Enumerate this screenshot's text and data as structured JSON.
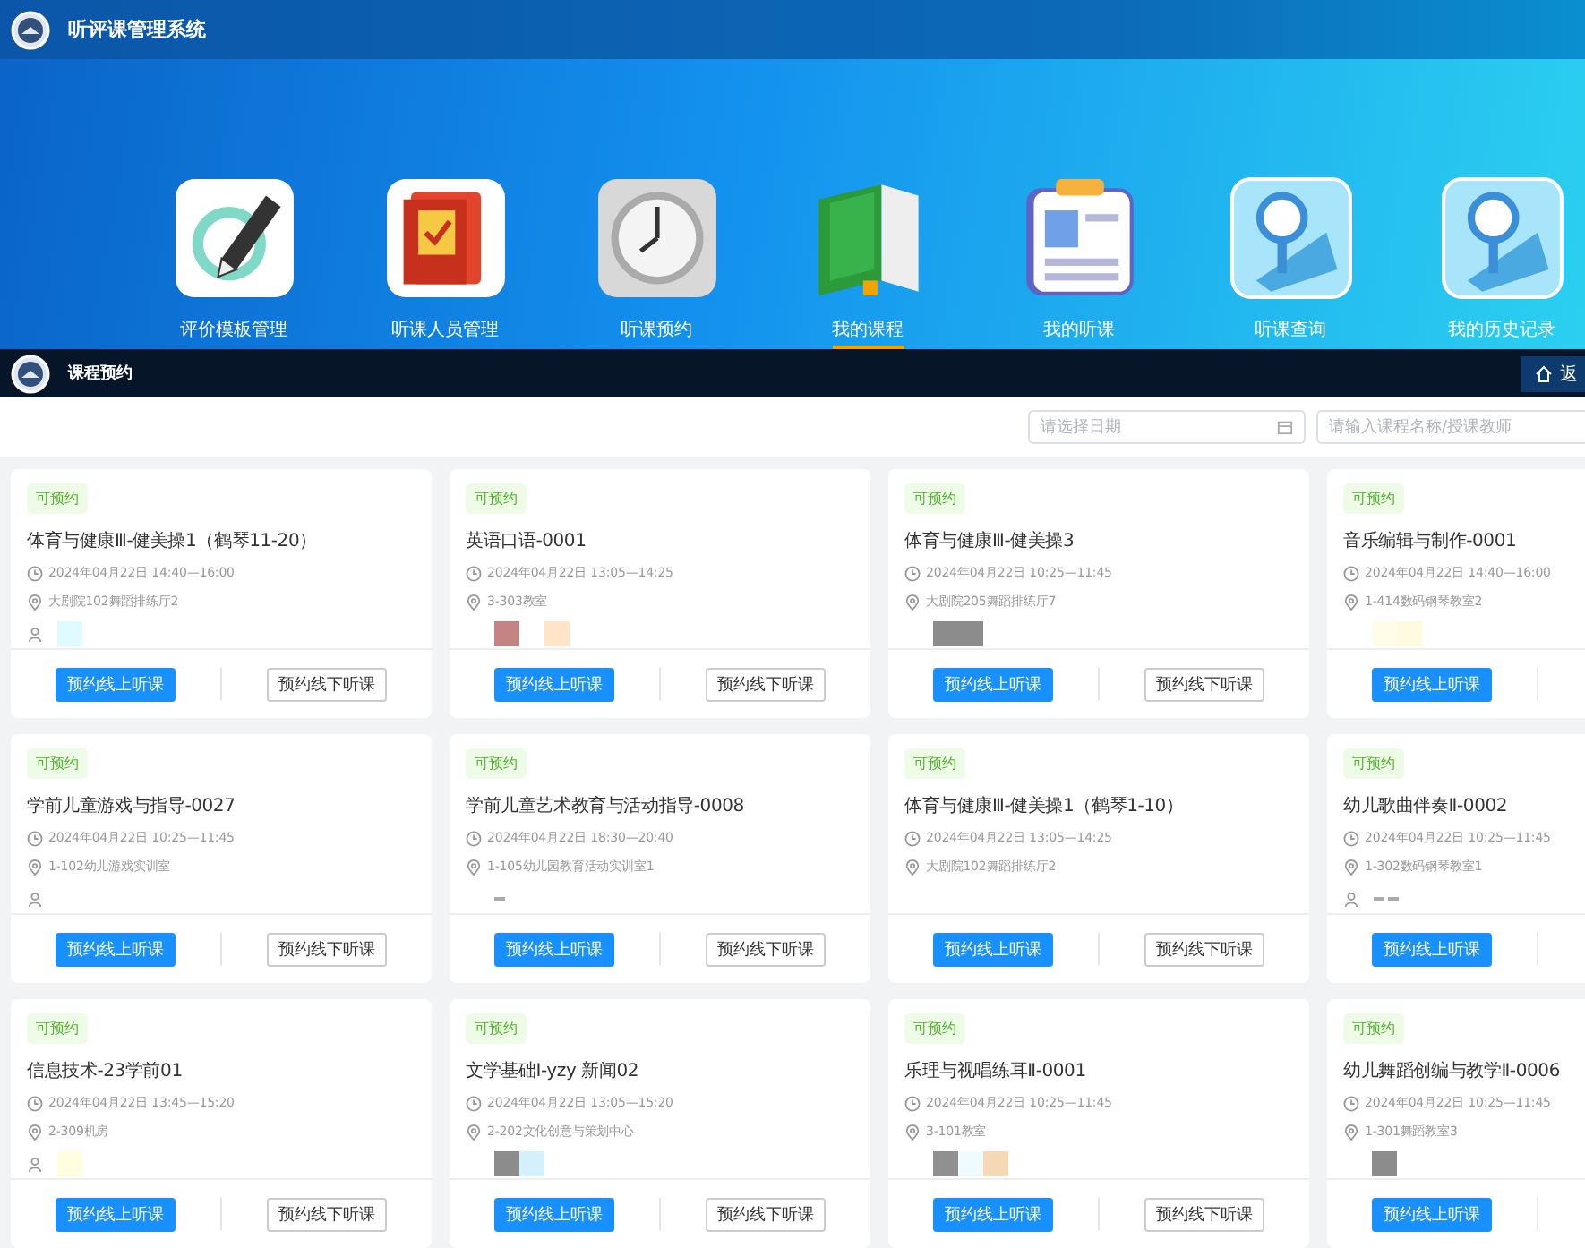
{
  "app": {
    "title": "听评课管理系统"
  },
  "nav": [
    {
      "label": "评价模板管理",
      "kind": "pen",
      "selected": false
    },
    {
      "label": "听课人员管理",
      "kind": "book",
      "selected": false
    },
    {
      "label": "听课预约",
      "kind": "clock",
      "selected": false
    },
    {
      "label": "我的课程",
      "kind": "course",
      "selected": true
    },
    {
      "label": "我的听课",
      "kind": "profile",
      "selected": false
    },
    {
      "label": "听课查询",
      "kind": "search",
      "selected": false
    },
    {
      "label": "我的历史记录",
      "kind": "search",
      "selected": false
    }
  ],
  "subbar": {
    "title": "课程预约",
    "back_button": "返"
  },
  "filters": {
    "date_placeholder": "请选择日期",
    "search_placeholder": "请输入课程名称/授课教师"
  },
  "cards": [
    {
      "tag": "可预约",
      "title": "体育与健康Ⅲ-健美操1（鹤琴11-20）",
      "time": "2024年04月22日 14:40—16:00",
      "location": "大剧院102舞蹈排练厅2",
      "person_icon": true,
      "blocks": [
        {
          "kind": "square",
          "color": "#e0fbff"
        }
      ],
      "online_button": "预约线上听课",
      "offline_button": "预约线下听课"
    },
    {
      "tag": "可预约",
      "title": "英语口语-0001",
      "time": "2024年04月22日 13:05—14:25",
      "location": "3-303教室",
      "person_icon": false,
      "blocks": [
        {
          "kind": "square",
          "color": "#c48484"
        },
        {
          "kind": "gap"
        },
        {
          "kind": "square",
          "color": "#ffe4c8"
        }
      ],
      "online_button": "预约线上听课",
      "offline_button": "预约线下听课"
    },
    {
      "tag": "可预约",
      "title": "体育与健康Ⅲ-健美操3",
      "time": "2024年04月22日 10:25—11:45",
      "location": "大剧院205舞蹈排练厅7",
      "person_icon": false,
      "blocks": [
        {
          "kind": "wide",
          "color": "#8c8c8c"
        }
      ],
      "online_button": "预约线上听课",
      "offline_button": "预约线下听课"
    },
    {
      "tag": "可预约",
      "title": "音乐编辑与制作-0001",
      "time": "2024年04月22日 14:40—16:00",
      "location": "1-414数码钢琴教室2",
      "person_icon": false,
      "blocks": [
        {
          "kind": "square",
          "color": "#fffde8"
        },
        {
          "kind": "square",
          "color": "#fffbe0"
        }
      ],
      "online_button": "预约线上听课"
    },
    {
      "tag": "可预约",
      "title": "学前儿童游戏与指导-0027",
      "time": "2024年04月22日 10:25—11:45",
      "location": "1-102幼儿游戏实训室",
      "person_icon": true,
      "online_button": "预约线上听课",
      "offline_button": "预约线下听课"
    },
    {
      "tag": "可预约",
      "title": "学前儿童艺术教育与活动指导-0008",
      "time": "2024年04月22日 18:30—20:40",
      "location": "1-105幼儿园教育活动实训室1",
      "person_icon": false,
      "blocks": [
        {
          "kind": "dash",
          "color": "#aaaaaa"
        }
      ],
      "online_button": "预约线上听课",
      "offline_button": "预约线下听课"
    },
    {
      "tag": "可预约",
      "title": "体育与健康Ⅲ-健美操1（鹤琴1-10）",
      "time": "2024年04月22日 13:05—14:25",
      "location": "大剧院102舞蹈排练厅2",
      "person_icon": false,
      "online_button": "预约线上听课",
      "offline_button": "预约线下听课"
    },
    {
      "tag": "可预约",
      "title": "幼儿歌曲伴奏Ⅱ-0002",
      "time": "2024年04月22日 10:25—11:45",
      "location": "1-302数码钢琴教室1",
      "person_icon": true,
      "blocks": [
        {
          "kind": "dash",
          "color": "#aaaaaa"
        },
        {
          "kind": "dash",
          "color": "#aaaaaa"
        }
      ],
      "online_button": "预约线上听课"
    },
    {
      "tag": "可预约",
      "title": "信息技术-23学前01",
      "time": "2024年04月22日 13:45—15:20",
      "location": "2-309机房",
      "person_icon": true,
      "blocks": [
        {
          "kind": "square",
          "color": "#ffffe0"
        }
      ],
      "online_button": "预约线上听课",
      "offline_button": "预约线下听课"
    },
    {
      "tag": "可预约",
      "title": "文学基础Ⅰ-yzy 新闻02",
      "time": "2024年04月22日 13:05—15:20",
      "location": "2-202文化创意与策划中心",
      "person_icon": false,
      "blocks": [
        {
          "kind": "square",
          "color": "#8c8c8c"
        },
        {
          "kind": "square",
          "color": "#d4f0fc"
        }
      ],
      "online_button": "预约线上听课",
      "offline_button": "预约线下听课"
    },
    {
      "tag": "可预约",
      "title": "乐理与视唱练耳Ⅱ-0001",
      "time": "2024年04月22日 10:25—11:45",
      "location": "3-101教室",
      "person_icon": false,
      "blocks": [
        {
          "kind": "square",
          "color": "#909090"
        },
        {
          "kind": "square",
          "color": "#f0fbff"
        },
        {
          "kind": "square",
          "color": "#f5d9b4"
        }
      ],
      "online_button": "预约线上听课",
      "offline_button": "预约线下听课"
    },
    {
      "tag": "可预约",
      "title": "幼儿舞蹈创编与教学Ⅱ-0006",
      "time": "2024年04月22日 10:25—11:45",
      "location": "1-301舞蹈教室3",
      "person_icon": false,
      "blocks": [
        {
          "kind": "square",
          "color": "#8c8c8c"
        }
      ],
      "online_button": "预约线上听课"
    }
  ]
}
